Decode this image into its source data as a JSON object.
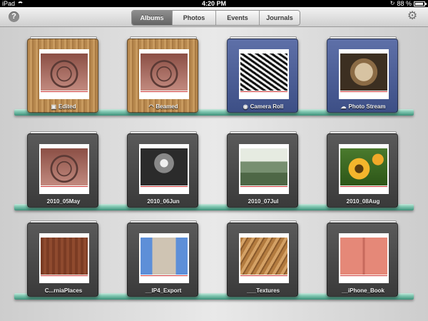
{
  "status_bar": {
    "carrier": "iPad",
    "time": "4:20 PM",
    "battery_percent": "88 %",
    "battery_level": 0.88
  },
  "toolbar": {
    "help_label": "?",
    "tabs": [
      {
        "label": "Albums",
        "active": true
      },
      {
        "label": "Photos",
        "active": false
      },
      {
        "label": "Events",
        "active": false
      },
      {
        "label": "Journals",
        "active": false
      }
    ],
    "settings_icon": "gear-icon"
  },
  "albums": [
    {
      "label": "Edited",
      "cover": "wood",
      "photo": "tx-wheel",
      "icon": "toolbox-icon"
    },
    {
      "label": "Beamed",
      "cover": "wood",
      "photo": "tx-wheel",
      "icon": "wifi-icon"
    },
    {
      "label": "Camera Roll",
      "cover": "blue",
      "photo": "tx-stairs",
      "icon": "camera-icon"
    },
    {
      "label": "Photo Stream",
      "cover": "blue",
      "photo": "tx-gauge",
      "icon": "cloud-icon"
    },
    {
      "label": "2010_05May",
      "cover": "dark",
      "photo": "tx-wheel",
      "icon": ""
    },
    {
      "label": "2010_06Jun",
      "cover": "dark",
      "photo": "tx-spiral",
      "icon": ""
    },
    {
      "label": "2010_07Jul",
      "cover": "dark",
      "photo": "tx-grass",
      "icon": ""
    },
    {
      "label": "2010_08Aug",
      "cover": "dark",
      "photo": "tx-sunflower",
      "icon": ""
    },
    {
      "label": "C...rniaPlaces",
      "cover": "dark",
      "photo": "tx-door",
      "icon": ""
    },
    {
      "label": "__IP4_Export",
      "cover": "dark",
      "photo": "tx-silo",
      "icon": ""
    },
    {
      "label": "___Textures",
      "cover": "dark",
      "photo": "tx-sand",
      "icon": ""
    },
    {
      "label": "__iPhone_Book",
      "cover": "dark",
      "photo": "tx-pinkdoor",
      "icon": ""
    }
  ]
}
